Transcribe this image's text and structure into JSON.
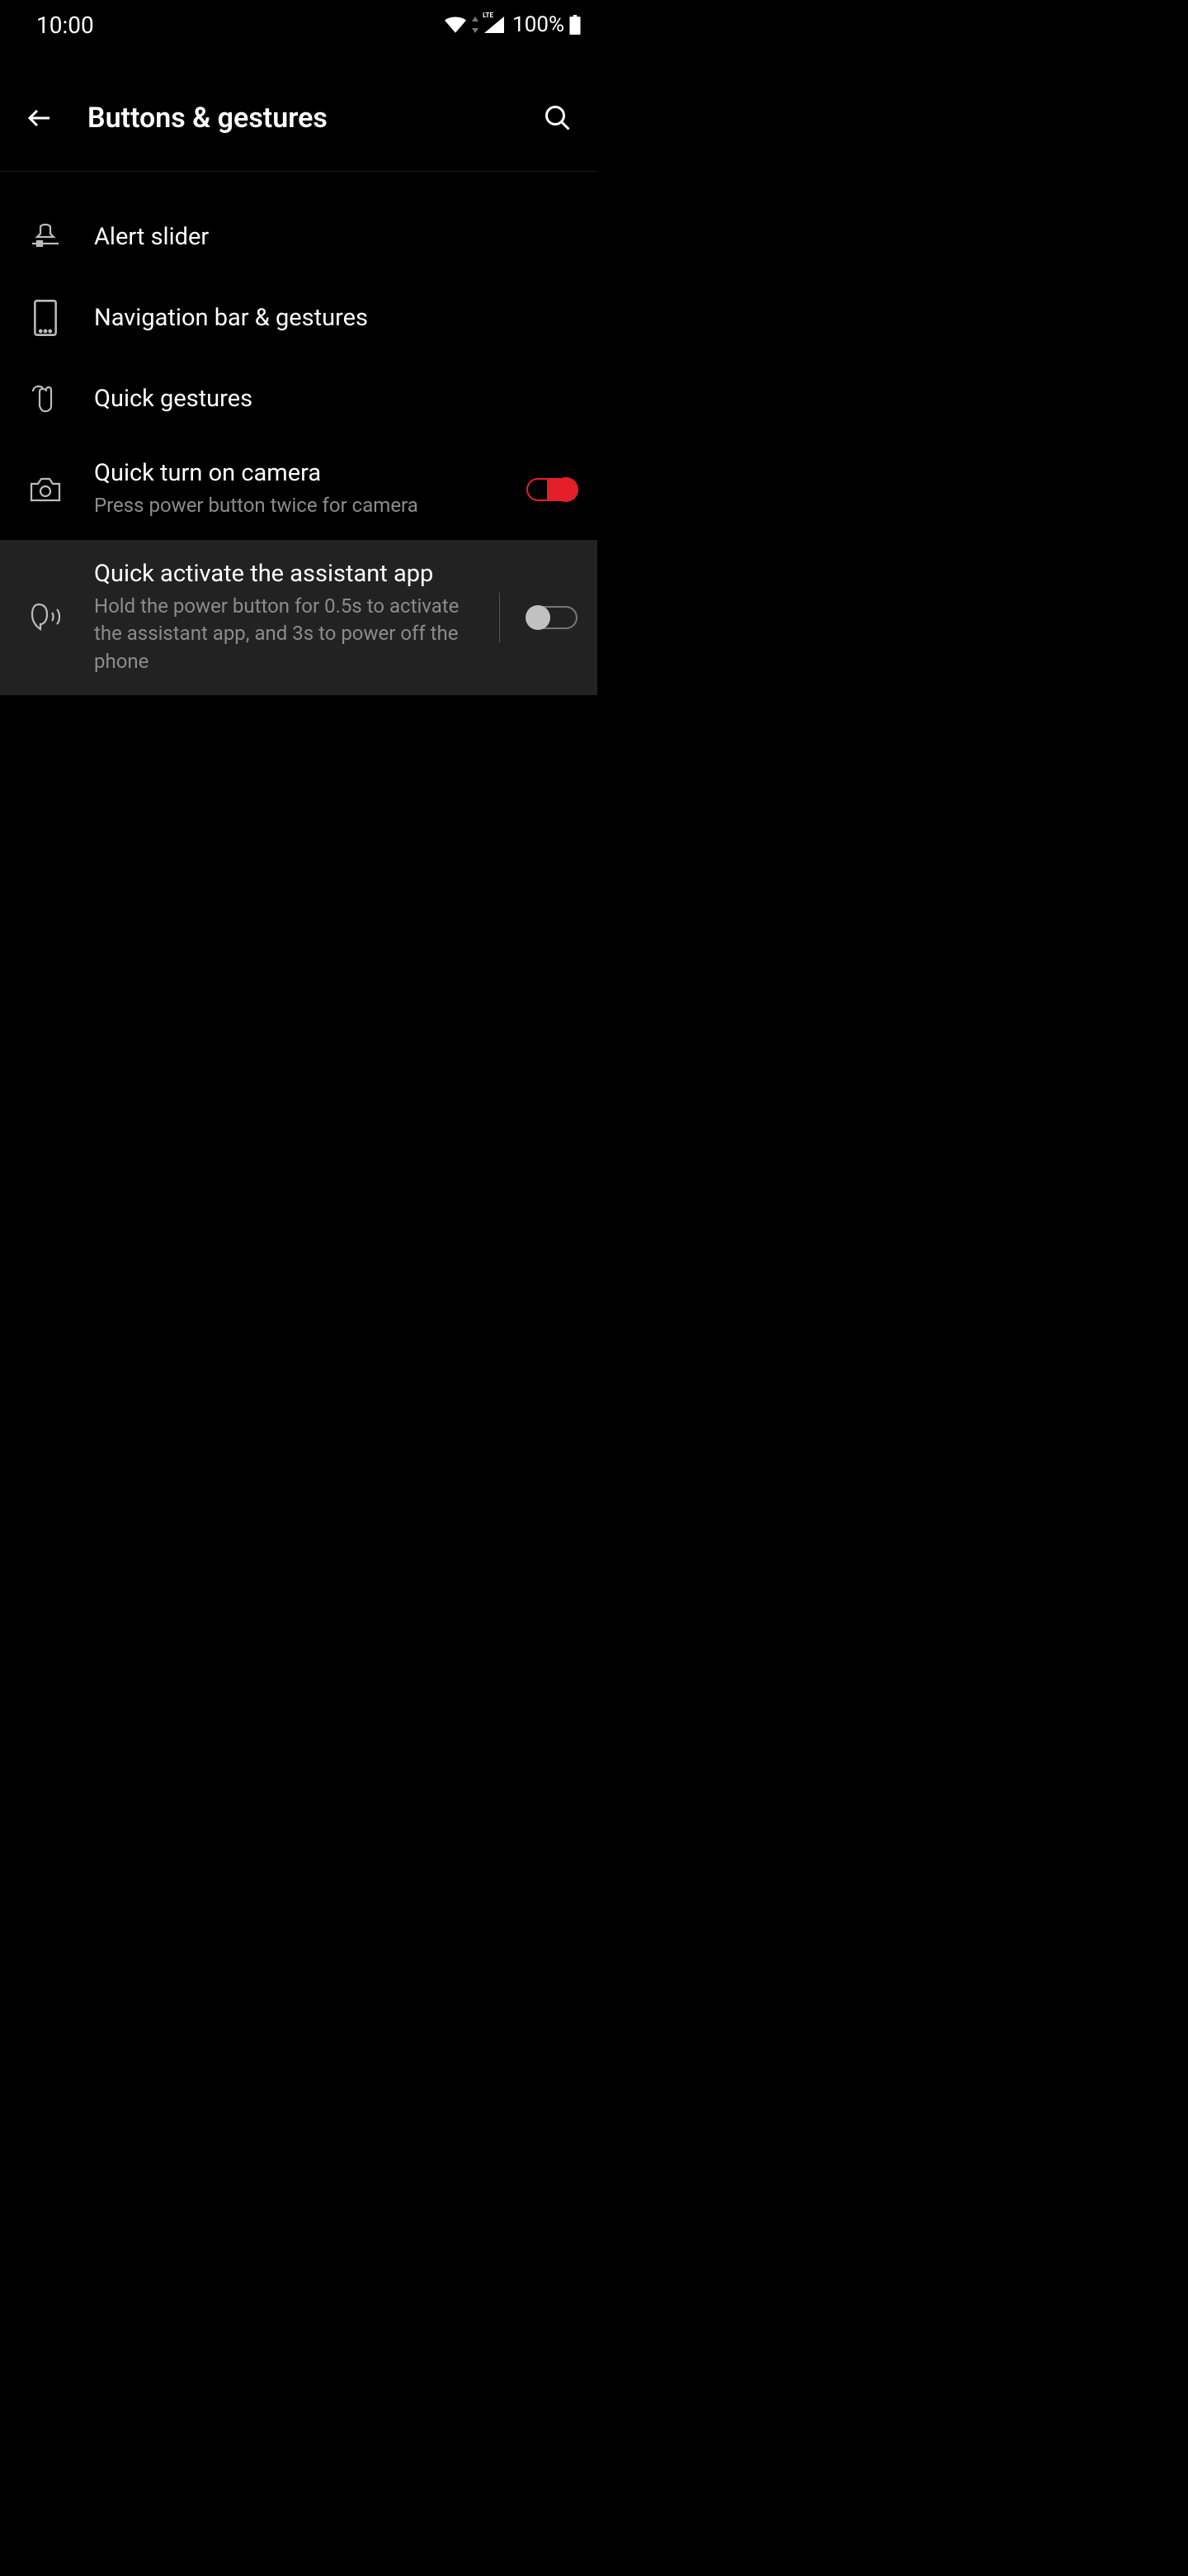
{
  "status": {
    "time": "10:00",
    "lte": "LTE",
    "battery_pct": "100%"
  },
  "header": {
    "title": "Buttons & gestures"
  },
  "rows": {
    "alert_slider": {
      "title": "Alert slider"
    },
    "nav_bar": {
      "title": "Navigation bar & gestures"
    },
    "quick_gestures": {
      "title": "Quick gestures"
    },
    "quick_camera": {
      "title": "Quick turn on camera",
      "sub": "Press power button twice for camera",
      "on": true
    },
    "quick_assistant": {
      "title": "Quick activate the assistant app",
      "sub": "Hold the power button for 0.5s to activate the assistant app, and 3s to power off the phone",
      "on": false
    }
  }
}
